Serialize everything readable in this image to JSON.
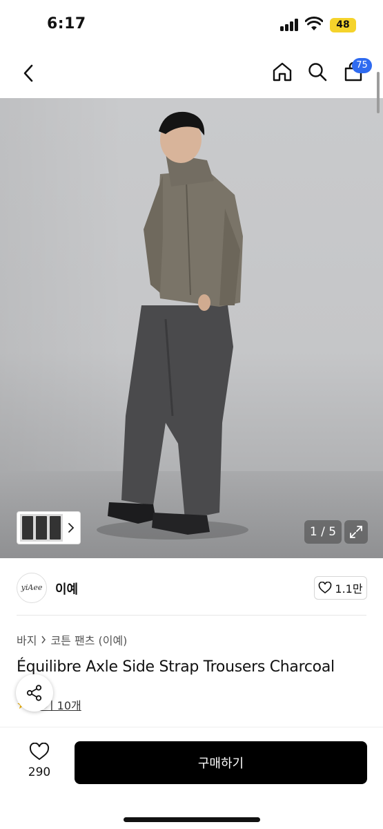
{
  "status_bar": {
    "time": "6:17",
    "battery": "48",
    "battery_color": "#f5d32b",
    "icons": [
      "signal-icon",
      "wifi-icon",
      "battery-icon"
    ]
  },
  "nav": {
    "icons": [
      "back-arrow-icon",
      "home-icon",
      "search-icon",
      "shopping-bag-icon"
    ],
    "cart_count": "75",
    "badge_color": "#2f6bf0"
  },
  "gallery": {
    "page_counter": "1 / 5",
    "icons": [
      "chevron-right-icon",
      "expand-icon"
    ]
  },
  "brand": {
    "logo_text": "yiAee",
    "name": "이예",
    "likes": "1.1만"
  },
  "product": {
    "breadcrumb": [
      "바지",
      "코튼 팬츠 (이예)"
    ],
    "title": "Équilibre Axle Side Strap Trousers Charcoal",
    "review_text": "후기 10개"
  },
  "bottom": {
    "wish_count": "290",
    "buy_label": "구매하기",
    "buy_color": "#000000"
  }
}
